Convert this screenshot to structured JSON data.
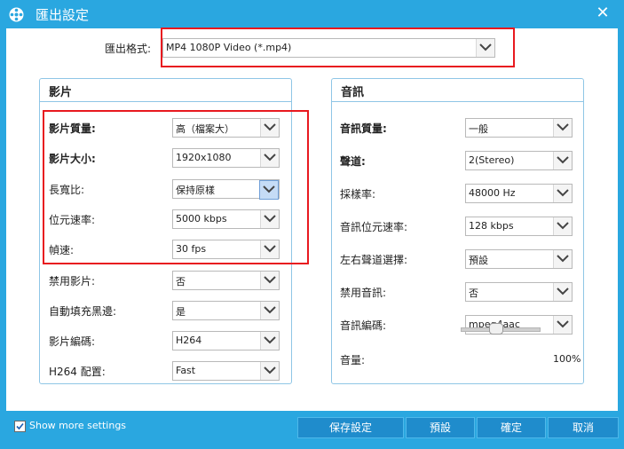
{
  "window": {
    "title": "匯出設定",
    "app_icon": "film-reel-icon",
    "close_glyph": "✕"
  },
  "export": {
    "label": "匯出格式:",
    "value": "MP4 1080P Video (*.mp4)"
  },
  "video": {
    "title": "影片",
    "rows": [
      {
        "label": "影片質量:",
        "value": "高（檔案大）"
      },
      {
        "label": "影片大小:",
        "value": "1920x1080"
      },
      {
        "label": "長寬比:",
        "value": "保持原樣"
      },
      {
        "label": "位元速率:",
        "value": "5000 kbps"
      },
      {
        "label": "幀速:",
        "value": "30 fps"
      },
      {
        "label": "禁用影片:",
        "value": "否"
      },
      {
        "label": "自動填充黑邊:",
        "value": "是"
      },
      {
        "label": "影片編碼:",
        "value": "H264"
      },
      {
        "label": "H264 配置:",
        "value": "Fast"
      }
    ]
  },
  "audio": {
    "title": "音訊",
    "rows": [
      {
        "label": "音訊質量:",
        "value": "一般"
      },
      {
        "label": "聲道:",
        "value": "2(Stereo)"
      },
      {
        "label": "採樣率:",
        "value": "48000 Hz"
      },
      {
        "label": "音訊位元速率:",
        "value": "128 kbps"
      },
      {
        "label": "左右聲道選擇:",
        "value": "預設"
      },
      {
        "label": "禁用音訊:",
        "value": "否"
      },
      {
        "label": "音訊編碼:",
        "value": "mpeg4aac"
      }
    ],
    "volume": {
      "label": "音量:",
      "value_text": "100%",
      "level": 0.5
    }
  },
  "footer": {
    "show_more": {
      "label": "Show more settings",
      "checked": true
    },
    "buttons": {
      "save": "保存設定",
      "default": "預設",
      "ok": "確定",
      "cancel": "取消"
    }
  },
  "colors": {
    "titlebar": "#2aa7e0",
    "highlight": "#e8191f",
    "group_border": "#8fc6e6"
  }
}
